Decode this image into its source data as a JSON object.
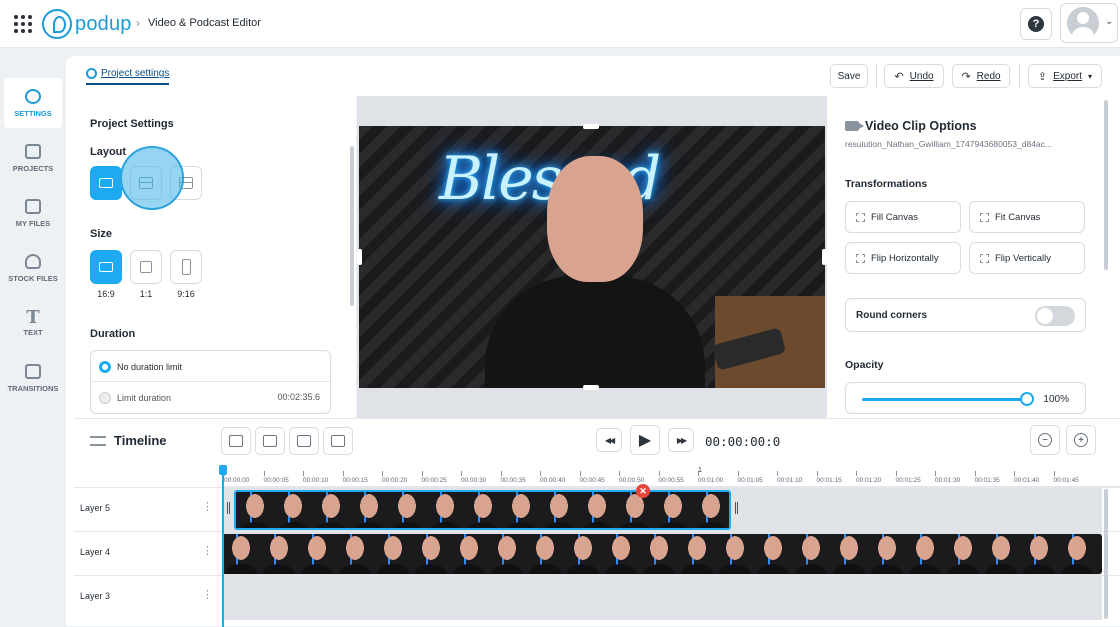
{
  "header": {
    "logo_text": "podup",
    "breadcrumb": "Video & Podcast Editor",
    "help_glyph": "?",
    "avatar_chevron": "⌄"
  },
  "sidebar": {
    "items": [
      {
        "label": "SETTINGS",
        "icon": "gear-icon",
        "active": true
      },
      {
        "label": "PROJECTS",
        "icon": "projects-icon"
      },
      {
        "label": "MY FILES",
        "icon": "my-files-icon"
      },
      {
        "label": "STOCK FILES",
        "icon": "cloud-icon"
      },
      {
        "label": "TEXT",
        "icon": "text-icon"
      },
      {
        "label": "TRANSITIONS",
        "icon": "transitions-icon"
      }
    ],
    "text_glyph": "T"
  },
  "toolbar": {
    "project_settings": "Project settings",
    "save": "Save",
    "undo": "Undo",
    "redo": "Redo",
    "export": "Export",
    "export_chevron": "▾"
  },
  "project_settings": {
    "title": "Project Settings",
    "layout_label": "Layout",
    "size_label": "Size",
    "sizes": [
      "16:9",
      "1:1",
      "9:16"
    ],
    "duration_label": "Duration",
    "duration_option_1": "No duration limit",
    "duration_option_2": "Limit duration",
    "duration_value": "00:02:35.6"
  },
  "video": {
    "neon_text": "Blessed"
  },
  "clip_options": {
    "title": "Video Clip Options",
    "filename": "resulution_Nathan_Gwilliam_1747943680053_d84ac...",
    "transformations_label": "Transformations",
    "fill_canvas": "Fill Canvas",
    "fit_canvas": "Fit Canvas",
    "flip_h": "Flip Horizontally",
    "flip_v": "Flip Vertically",
    "round_corners": "Round corners",
    "round_corners_on": false,
    "opacity_label": "Opacity",
    "opacity_value": "100%",
    "opacity": 1.0
  },
  "timeline": {
    "title": "Timeline",
    "time": "00:00:00:0",
    "rewind_glyph": "◀◀",
    "play_glyph": "▶",
    "forward_glyph": "▶▶",
    "zoom_out_glyph": "−",
    "zoom_in_glyph": "+",
    "marker": "1",
    "ticks": [
      "00:00:00",
      "00:00:05",
      "00:00:10",
      "00:00:15",
      "00:00:20",
      "00:00:25",
      "00:00:30",
      "00:00:35",
      "00:00:40",
      "00:00:45",
      "00:00:50",
      "00:00:55",
      "00:01:00",
      "00:01:05",
      "00:01:10",
      "00:01:15",
      "00:01:20",
      "00:01:25",
      "00:01:30",
      "00:01:35",
      "00:01:40",
      "00:01:45"
    ],
    "layers": [
      "Layer 5",
      "Layer 4",
      "Layer 3"
    ],
    "menu_glyph": "⋮",
    "delete_glyph": "✕"
  },
  "colors": {
    "accent": "#1eaaf0",
    "brand": "#1b9bd8",
    "delete": "#e8453c"
  }
}
